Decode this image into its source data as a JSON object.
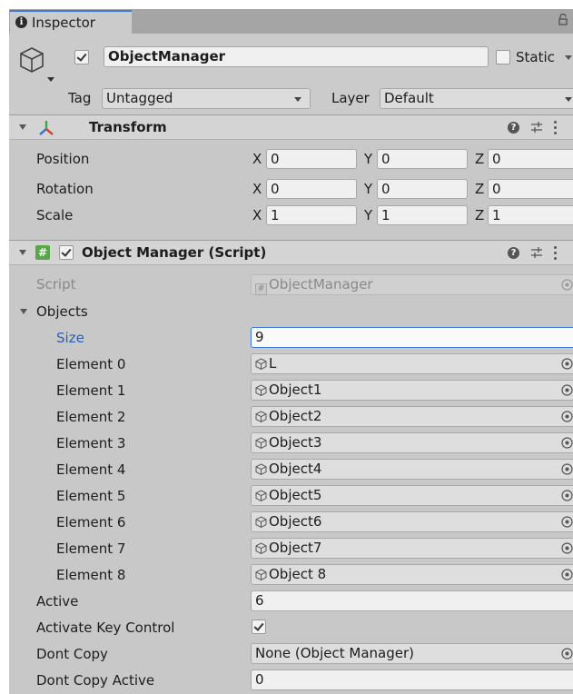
{
  "tab": {
    "label": "Inspector"
  },
  "header": {
    "active": true,
    "name": "ObjectManager",
    "static_label": "Static",
    "static_checked": false,
    "tag_label": "Tag",
    "tag_value": "Untagged",
    "layer_label": "Layer",
    "layer_value": "Default"
  },
  "transform": {
    "title": "Transform",
    "rows": [
      {
        "label": "Position",
        "x": "0",
        "y": "0",
        "z": "0"
      },
      {
        "label": "Rotation",
        "x": "0",
        "y": "0",
        "z": "0"
      },
      {
        "label": "Scale",
        "x": "1",
        "y": "1",
        "z": "1"
      }
    ],
    "axis": {
      "x": "X",
      "y": "Y",
      "z": "Z"
    }
  },
  "script_component": {
    "title": "Object Manager (Script)",
    "enabled": true,
    "script_label": "Script",
    "script_value": "ObjectManager",
    "objects_label": "Objects",
    "size_label": "Size",
    "size_value": "9",
    "elements": [
      {
        "label": "Element 0",
        "value": "L"
      },
      {
        "label": "Element 1",
        "value": "Object1"
      },
      {
        "label": "Element 2",
        "value": "Object2"
      },
      {
        "label": "Element 3",
        "value": "Object3"
      },
      {
        "label": "Element 4",
        "value": "Object4"
      },
      {
        "label": "Element 5",
        "value": "Object5"
      },
      {
        "label": "Element 6",
        "value": "Object6"
      },
      {
        "label": "Element 7",
        "value": "Object7"
      },
      {
        "label": "Element 8",
        "value": "Object 8"
      }
    ],
    "active_label": "Active",
    "active_value": "6",
    "activate_key_label": "Activate Key Control",
    "activate_key_checked": true,
    "dont_copy_label": "Dont Copy",
    "dont_copy_value": "None (Object Manager)",
    "dont_copy_active_label": "Dont Copy Active",
    "dont_copy_active_value": "0"
  },
  "colors": {
    "accent": "#3a79d9",
    "panel": "#c8c8c8",
    "header": "#d4d4d4"
  }
}
